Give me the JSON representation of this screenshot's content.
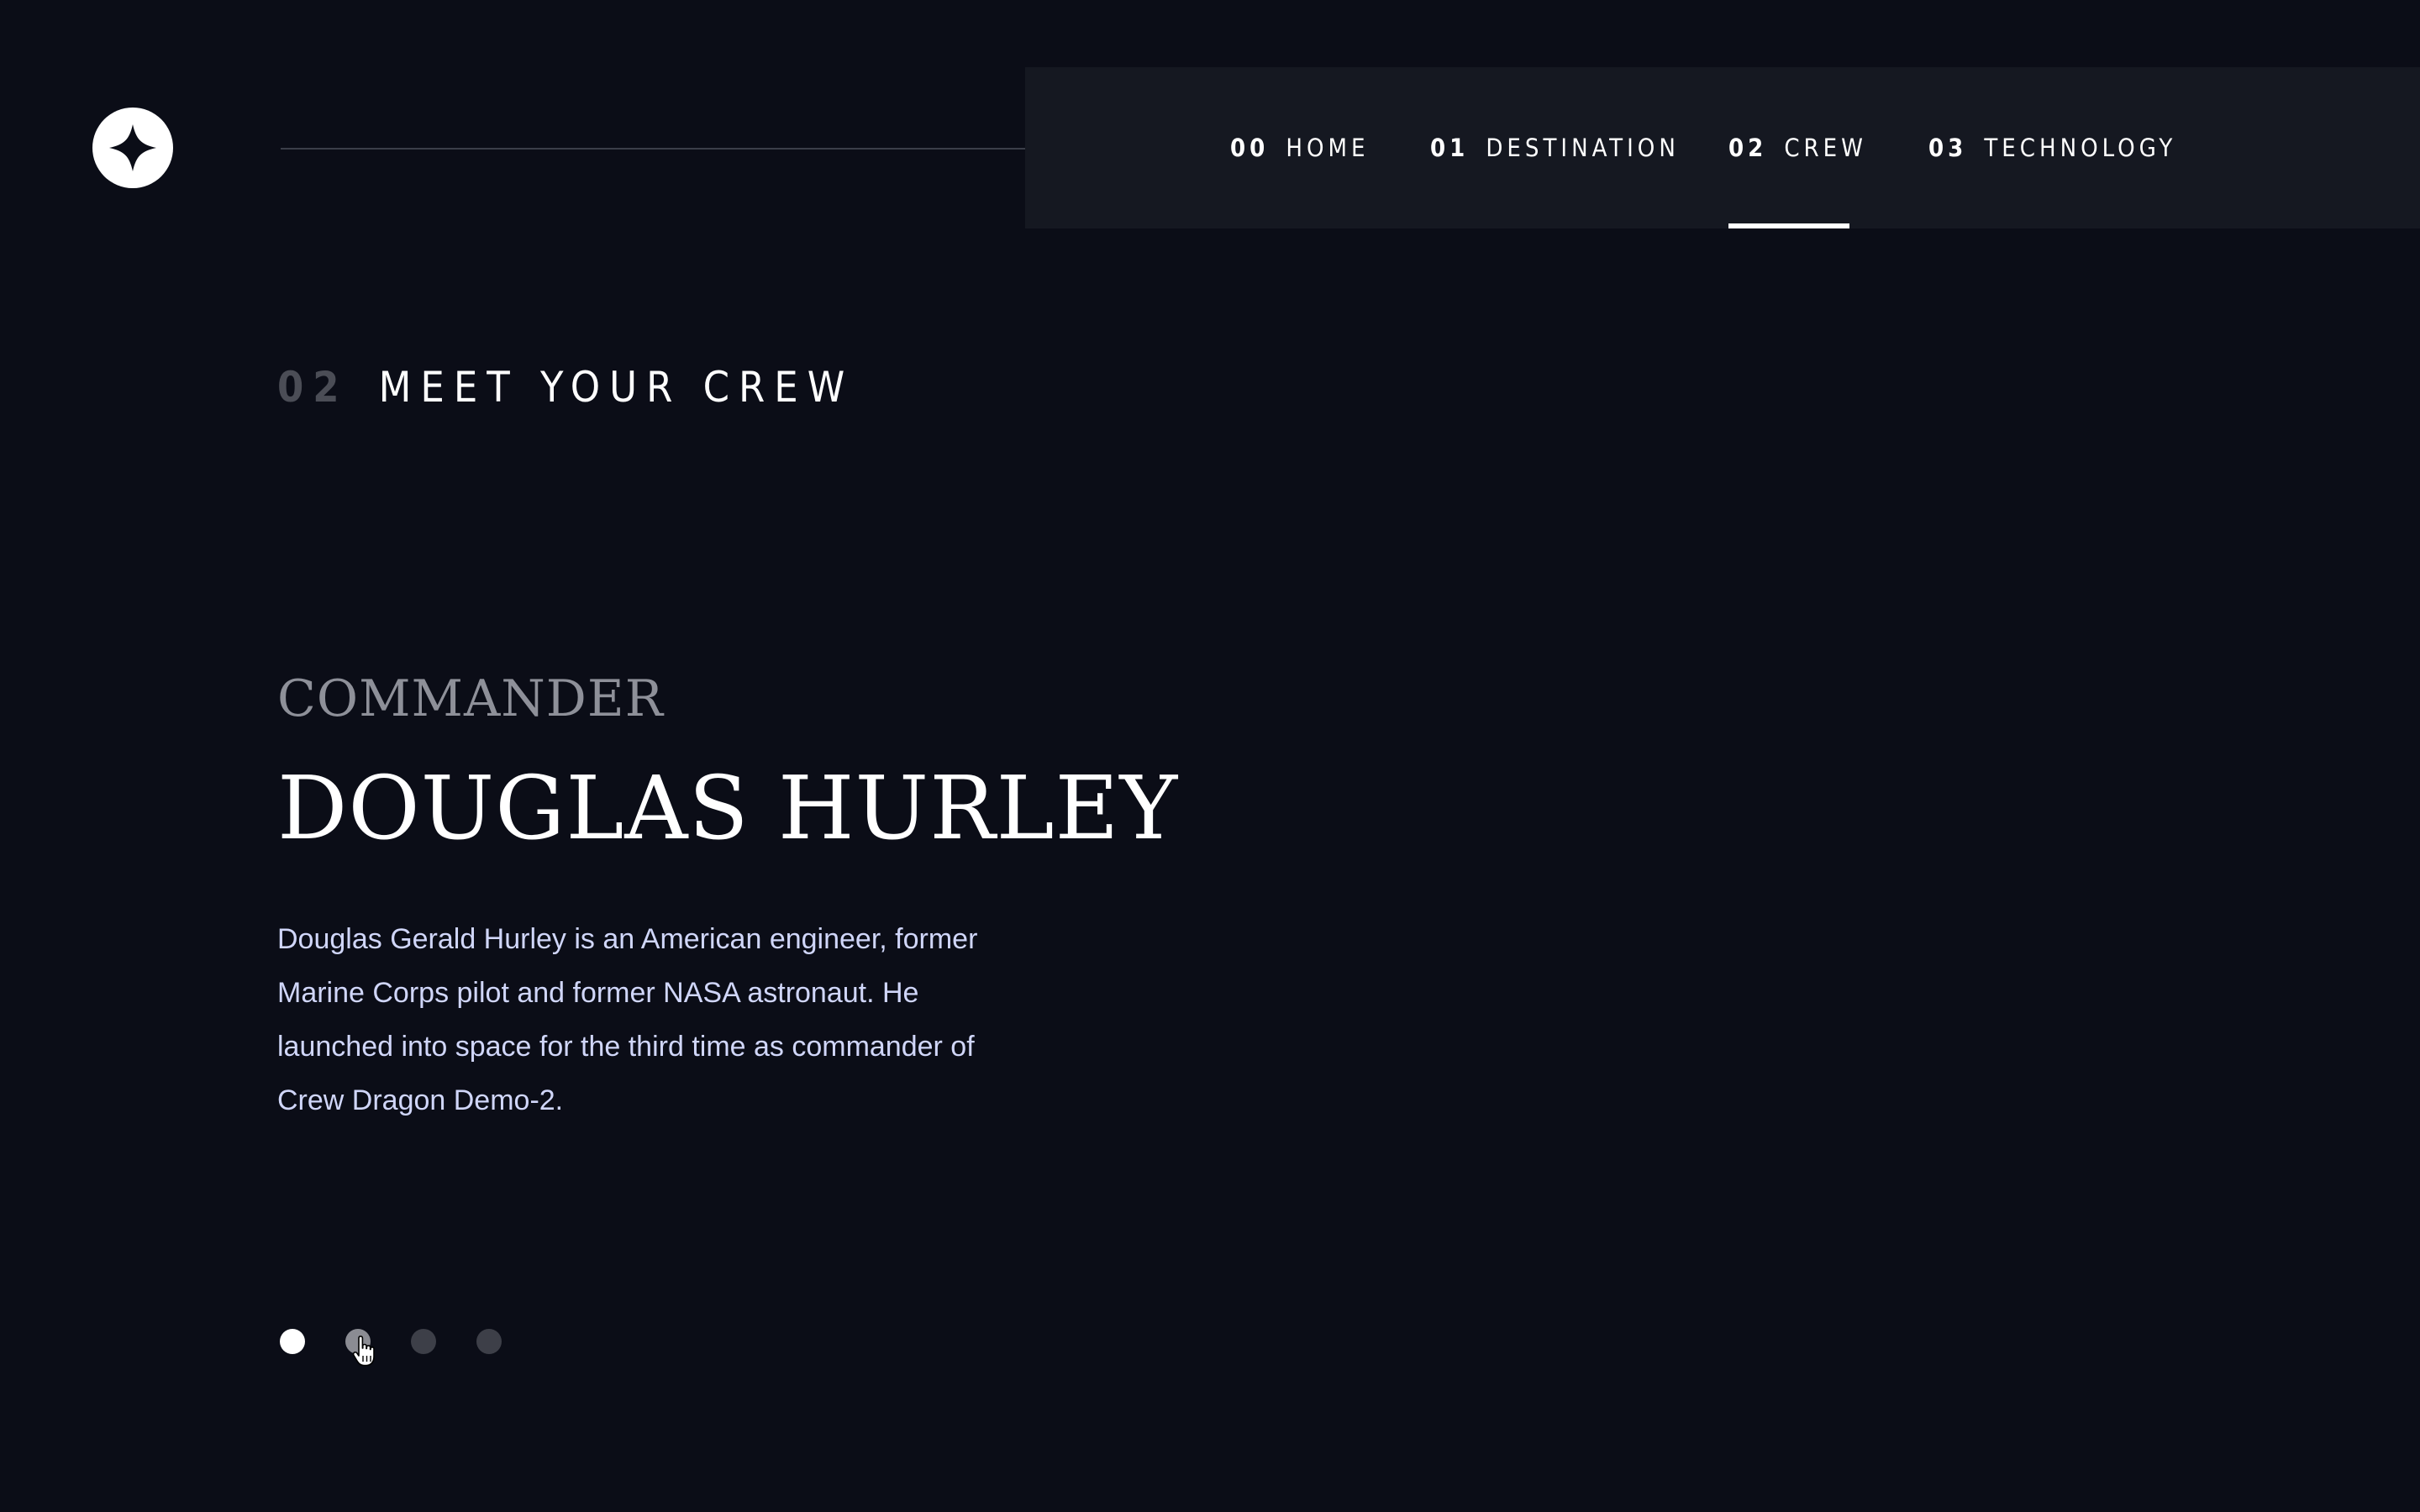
{
  "logo": {
    "icon": "four-point-star-icon"
  },
  "nav": {
    "items": [
      {
        "num": "00",
        "label": "HOME"
      },
      {
        "num": "01",
        "label": "DESTINATION"
      },
      {
        "num": "02",
        "label": "CREW",
        "active": true
      },
      {
        "num": "03",
        "label": "TECHNOLOGY"
      }
    ]
  },
  "section": {
    "num": "02",
    "title": "MEET YOUR CREW"
  },
  "crew": {
    "role": "COMMANDER",
    "name": "DOUGLAS HURLEY",
    "bio": "Douglas Gerald Hurley is an American engineer, former Marine Corps pilot and former NASA astronaut. He launched into space for the third time as commander of Crew Dragon Demo-2."
  },
  "pagination": {
    "count": 4,
    "active_index": 0,
    "hovered_index": 1
  },
  "cursor": {
    "icon": "hand-pointer-icon"
  },
  "colors": {
    "background": "#0b0d17",
    "nav_background": "#151821",
    "text_primary": "#ffffff",
    "text_body": "#d0d6f9",
    "text_muted": "#8e9099",
    "dot_inactive": "#3d3f48"
  }
}
